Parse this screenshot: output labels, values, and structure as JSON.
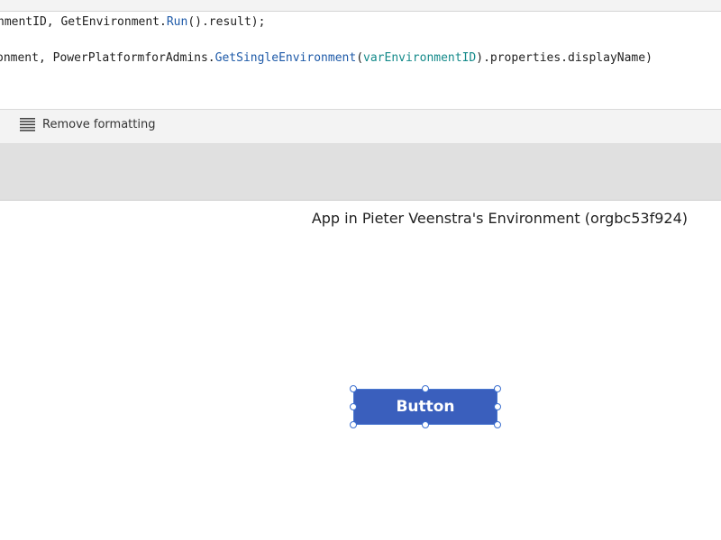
{
  "formula": {
    "line1": {
      "pre": "nmentID, GetEnvironment.",
      "fn": "Run",
      "post": "().result);"
    },
    "line2": {
      "pre": "onment, PowerPlatformforAdmins.",
      "fn": "GetSingleEnvironment",
      "open": "(",
      "var": "varEnvironmentID",
      "post": ").properties.displayName)"
    }
  },
  "toolbar": {
    "remove_formatting_label": "Remove formatting",
    "remove_formatting_icon": "lines-icon"
  },
  "canvas": {
    "environment_label": "App in Pieter Veenstra's Environment (orgbc53f924)",
    "button_label": "Button",
    "button_color": "#3a5fbd"
  }
}
